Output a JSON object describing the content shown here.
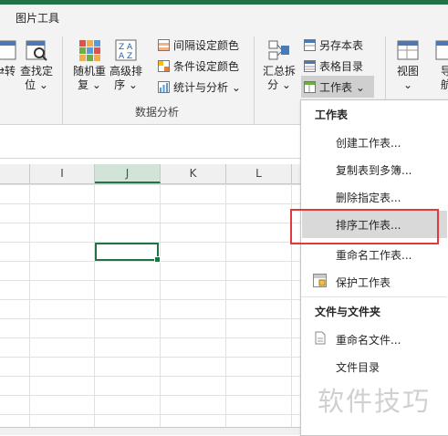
{
  "tabs": {
    "active": "图片工具"
  },
  "ribbon": {
    "buttons": {
      "turn": "⇄转",
      "find_locate": "查找定",
      "find_locate2": "位 ⌄",
      "random_repeat": "随机重",
      "random_repeat2": "复 ⌄",
      "advanced_sort": "高级排",
      "advanced_sort2": "序 ⌄",
      "summary_split": "汇总拆",
      "summary_split2": "分 ⌄",
      "view": "视图",
      "view2": "⌄",
      "nav": "导",
      "nav2": "航"
    },
    "small": {
      "interval_color": "间隔设定颜色",
      "condition_color": "条件设定颜色",
      "stats_analysis": "统计与分析 ⌄",
      "save_as_table": "另存本表",
      "table_directory": "表格目录",
      "worksheet": "工作表 ⌄"
    },
    "group_label": "数据分析"
  },
  "columns": [
    "I",
    "J",
    "K",
    "L"
  ],
  "selected_column": "J",
  "menu": {
    "header_worksheet": "工作表",
    "items_ws": [
      "创建工作表...",
      "复制表到多簿...",
      "删除指定表...",
      "排序工作表...",
      "重命名工作表...",
      "保护工作表"
    ],
    "header_files": "文件与文件夹",
    "items_files": [
      "重命名文件...",
      "文件目录"
    ]
  },
  "watermark": "软件技巧",
  "colors": {
    "accent": "#217346",
    "highlight": "#e0393e"
  }
}
